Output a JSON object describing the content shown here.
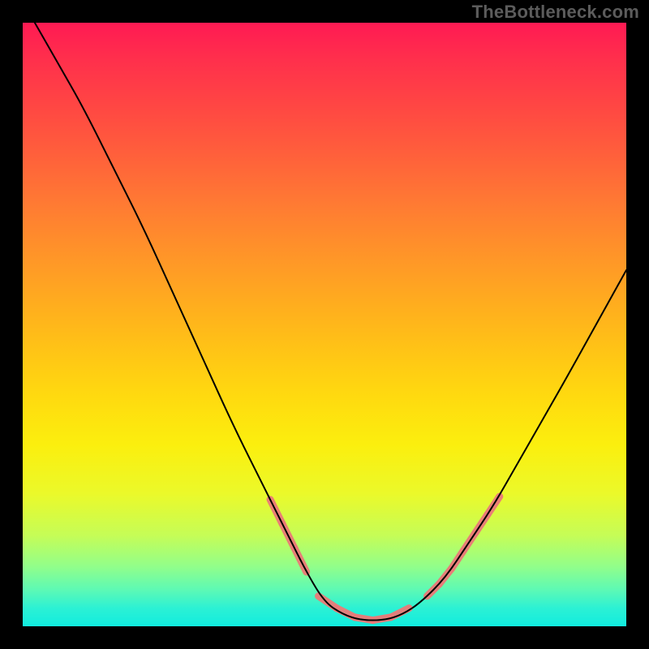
{
  "watermark": "TheBottleneck.com",
  "chart_data": {
    "type": "line",
    "title": "",
    "xlabel": "",
    "ylabel": "",
    "xlim": [
      0,
      100
    ],
    "ylim": [
      0,
      100
    ],
    "gradient_stops": [
      {
        "pos": 0,
        "color": "#ff1a53"
      },
      {
        "pos": 14,
        "color": "#ff4743"
      },
      {
        "pos": 30,
        "color": "#ff7a33"
      },
      {
        "pos": 46,
        "color": "#ffab1f"
      },
      {
        "pos": 62,
        "color": "#ffda0f"
      },
      {
        "pos": 78,
        "color": "#ebf92a"
      },
      {
        "pos": 90,
        "color": "#93fe89"
      },
      {
        "pos": 100,
        "color": "#11ecdf"
      }
    ],
    "series": [
      {
        "name": "bottleneck-curve",
        "color": "#000000",
        "data": [
          {
            "x": 2,
            "y": 100
          },
          {
            "x": 6,
            "y": 93
          },
          {
            "x": 10,
            "y": 86
          },
          {
            "x": 15,
            "y": 76
          },
          {
            "x": 20,
            "y": 66
          },
          {
            "x": 25,
            "y": 55
          },
          {
            "x": 30,
            "y": 44
          },
          {
            "x": 35,
            "y": 33
          },
          {
            "x": 40,
            "y": 23
          },
          {
            "x": 44,
            "y": 15
          },
          {
            "x": 47,
            "y": 9
          },
          {
            "x": 50,
            "y": 4
          },
          {
            "x": 53,
            "y": 2
          },
          {
            "x": 56,
            "y": 1
          },
          {
            "x": 60,
            "y": 1
          },
          {
            "x": 63,
            "y": 2
          },
          {
            "x": 66,
            "y": 4
          },
          {
            "x": 70,
            "y": 8
          },
          {
            "x": 74,
            "y": 14
          },
          {
            "x": 78,
            "y": 20
          },
          {
            "x": 82,
            "y": 27
          },
          {
            "x": 86,
            "y": 34
          },
          {
            "x": 90,
            "y": 41
          },
          {
            "x": 95,
            "y": 50
          },
          {
            "x": 100,
            "y": 59
          }
        ]
      },
      {
        "name": "highlight-segments",
        "color": "#eb7a78",
        "stroke_width": 9,
        "dash": true,
        "data": [
          {
            "segment": "left",
            "points": [
              {
                "x": 41,
                "y": 21
              },
              {
                "x": 43,
                "y": 17
              },
              {
                "x": 45,
                "y": 13
              },
              {
                "x": 47,
                "y": 9
              }
            ]
          },
          {
            "segment": "bottom",
            "points": [
              {
                "x": 49,
                "y": 5
              },
              {
                "x": 52,
                "y": 3
              },
              {
                "x": 55,
                "y": 1.5
              },
              {
                "x": 58,
                "y": 1
              },
              {
                "x": 61,
                "y": 1.5
              },
              {
                "x": 64,
                "y": 3
              }
            ]
          },
          {
            "segment": "right",
            "points": [
              {
                "x": 67,
                "y": 5
              },
              {
                "x": 69,
                "y": 7
              },
              {
                "x": 71,
                "y": 9.5
              },
              {
                "x": 73,
                "y": 12.5
              },
              {
                "x": 75,
                "y": 15.5
              },
              {
                "x": 77,
                "y": 18.5
              },
              {
                "x": 79,
                "y": 21.5
              }
            ]
          }
        ]
      }
    ]
  }
}
